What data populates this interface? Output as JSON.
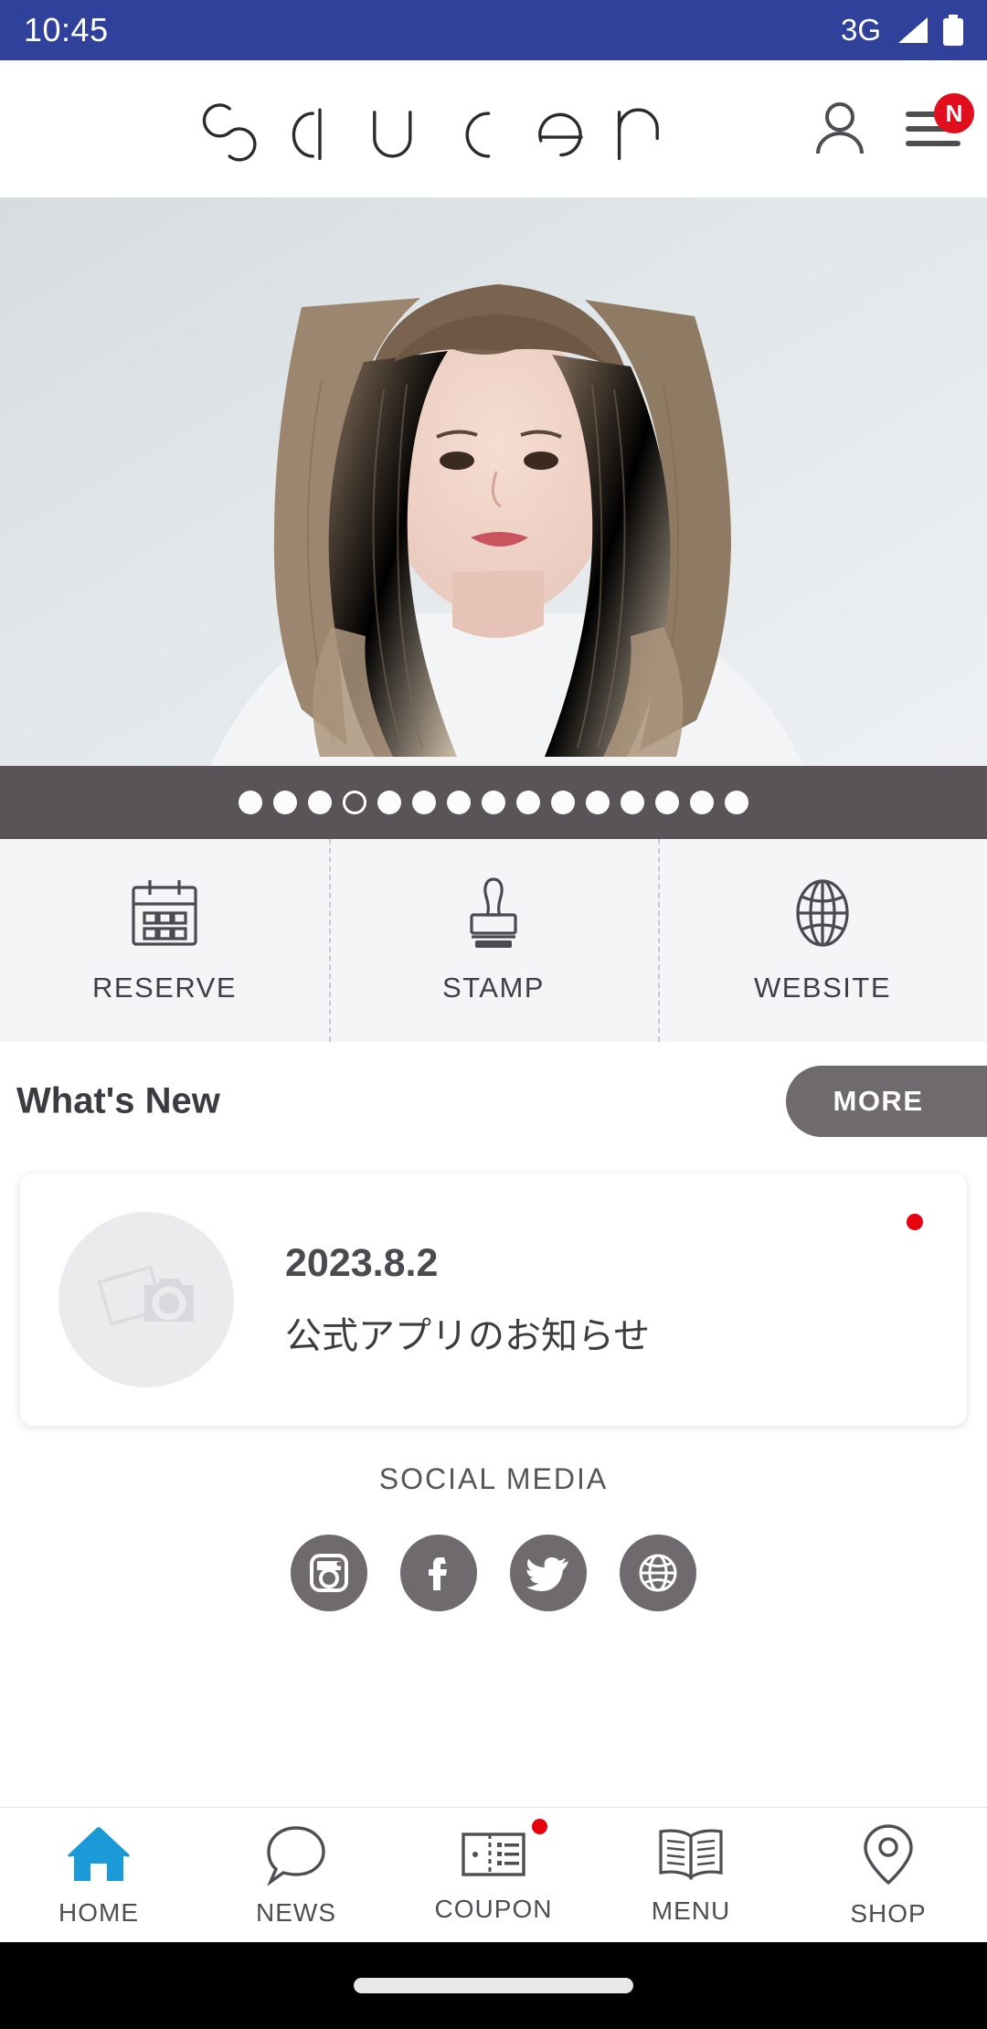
{
  "status_bar": {
    "time": "10:45",
    "network": "3G",
    "signal_icon": "signal-bars-icon",
    "battery_icon": "battery-full-icon"
  },
  "header": {
    "logo_text": "saucer",
    "account_icon": "person-icon",
    "menu_icon": "hamburger-menu-icon",
    "menu_badge": "N",
    "badge_color": "#e10f1e"
  },
  "hero": {
    "alt": "woman-with-long-wavy-light-brown-hair",
    "carousel": {
      "total_dots": 15,
      "active_index": 3,
      "bar_color": "#595457"
    }
  },
  "quick_actions": [
    {
      "label": "RESERVE",
      "icon": "calendar-icon"
    },
    {
      "label": "STAMP",
      "icon": "stamp-icon"
    },
    {
      "label": "WEBSITE",
      "icon": "globe-icon"
    }
  ],
  "whats_new": {
    "title": "What's New",
    "more_label": "MORE",
    "more_color": "#6e6a6d",
    "items": [
      {
        "date": "2023.8.2",
        "text": "公式アプリのお知らせ",
        "thumb_icon": "photo-camera-placeholder-icon",
        "unread": true,
        "unread_color": "#e7000e"
      }
    ]
  },
  "social_media": {
    "title": "SOCIAL MEDIA",
    "circle_color": "#6e6a6d",
    "items": [
      {
        "name": "instagram",
        "icon": "instagram-icon"
      },
      {
        "name": "facebook",
        "icon": "facebook-icon"
      },
      {
        "name": "twitter",
        "icon": "twitter-icon"
      },
      {
        "name": "website",
        "icon": "globe-icon"
      }
    ]
  },
  "bottom_nav": {
    "active_color": "#1a9ad7",
    "items": [
      {
        "label": "HOME",
        "icon": "home-icon",
        "active": true,
        "badge": false
      },
      {
        "label": "NEWS",
        "icon": "speech-bubble-icon",
        "active": false,
        "badge": false
      },
      {
        "label": "COUPON",
        "icon": "coupon-ticket-icon",
        "active": false,
        "badge": true
      },
      {
        "label": "MENU",
        "icon": "open-book-icon",
        "active": false,
        "badge": false
      },
      {
        "label": "SHOP",
        "icon": "location-pin-icon",
        "active": false,
        "badge": false
      }
    ]
  },
  "gesture_bar": {
    "handle": "home-gesture-handle"
  }
}
